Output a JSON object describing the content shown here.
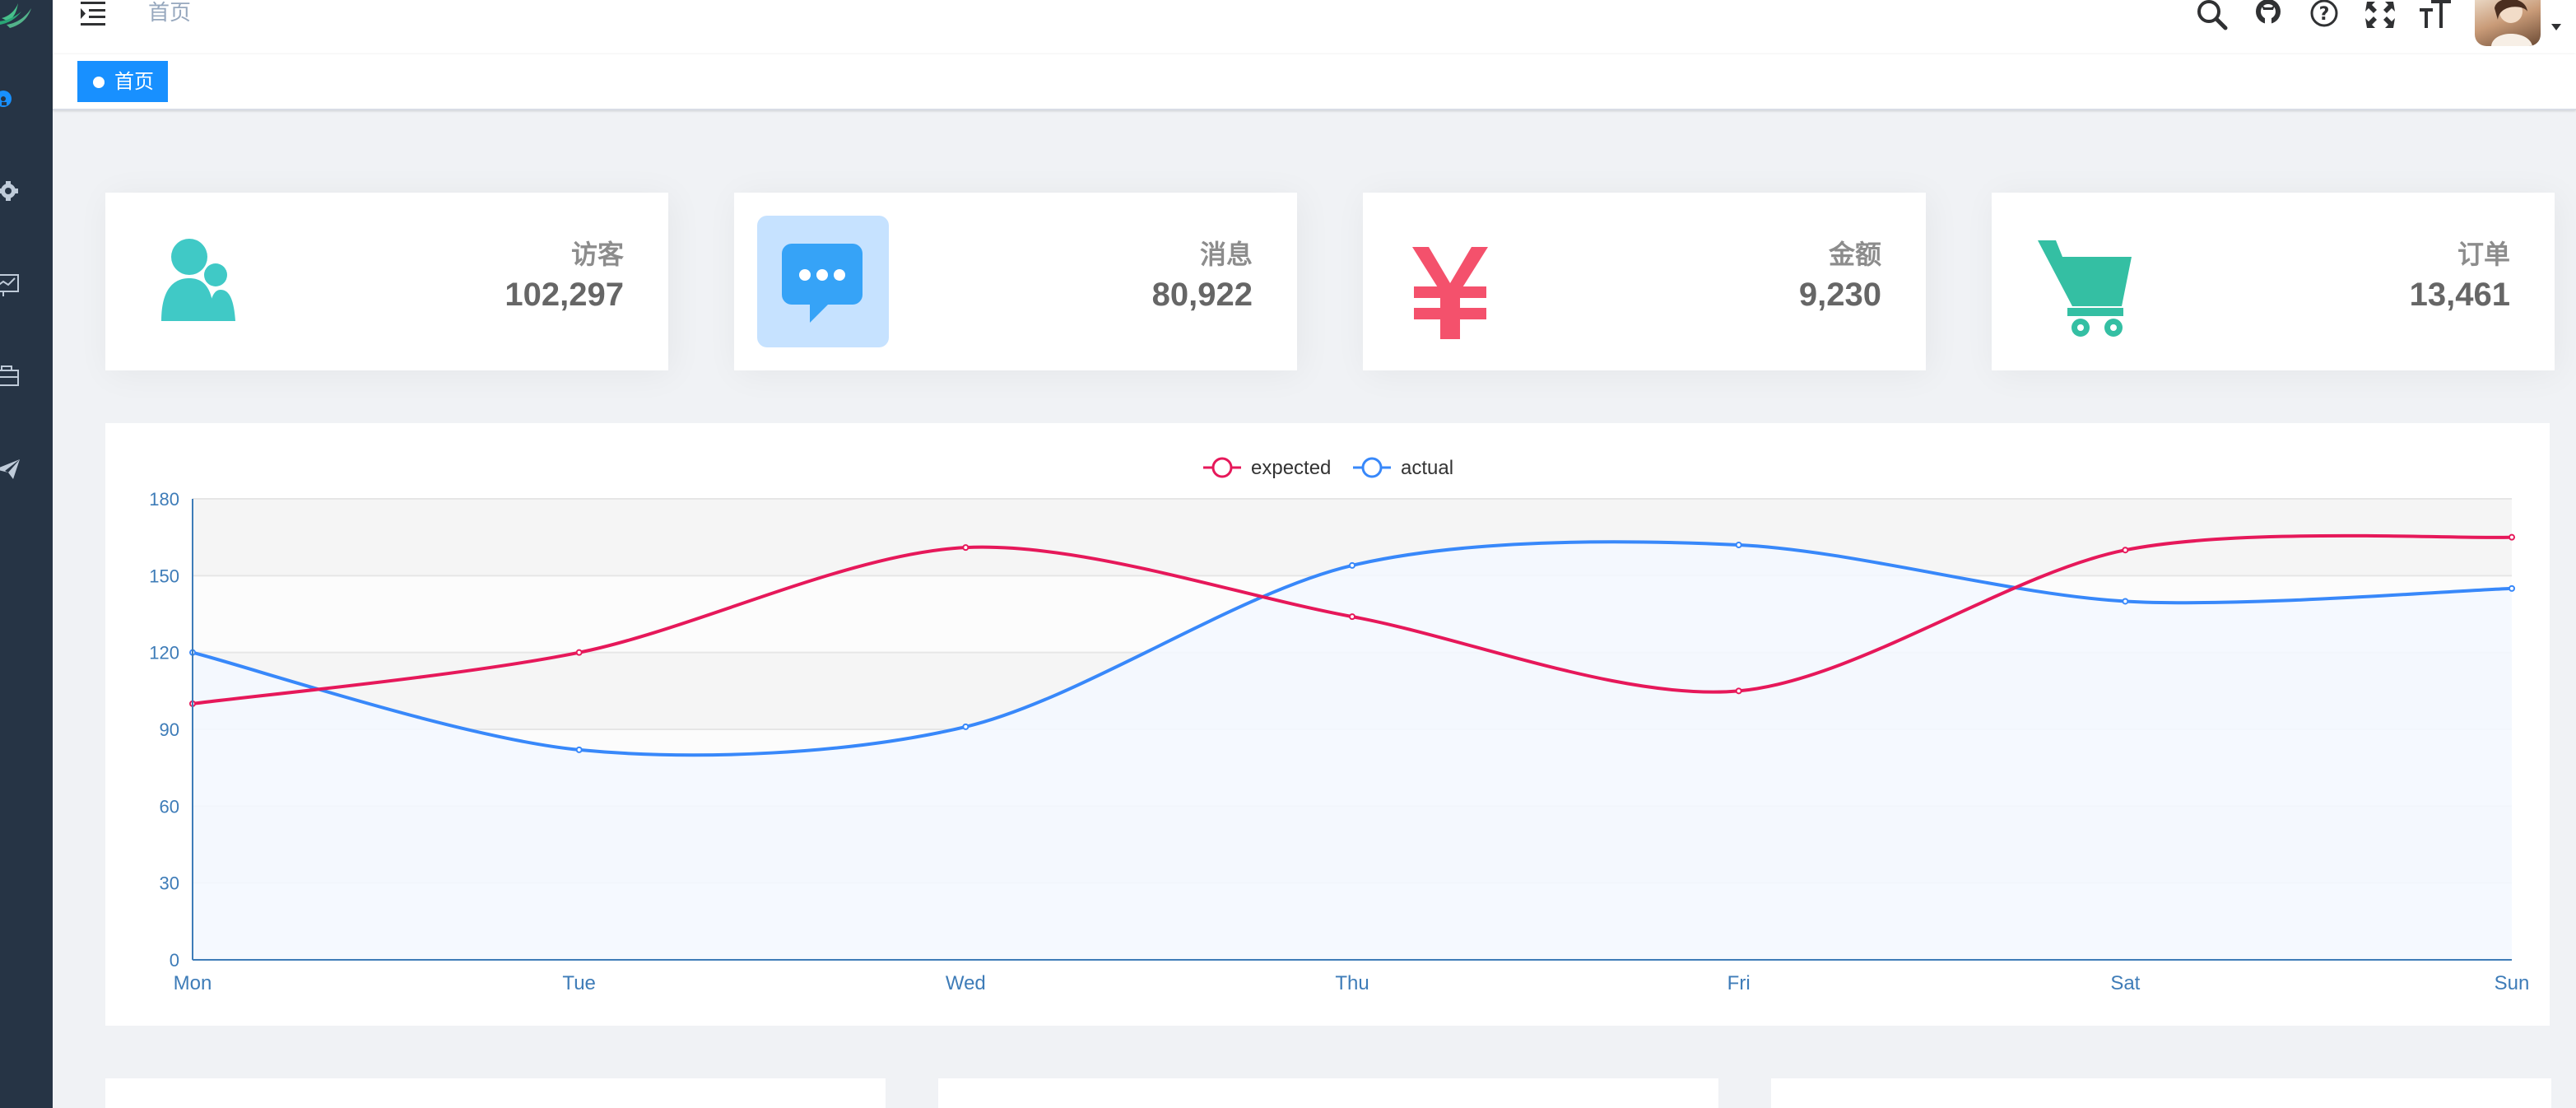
{
  "navbar": {
    "breadcrumb": "首页",
    "icons": [
      "search-icon",
      "github-icon",
      "help-icon",
      "fullscreen-icon",
      "font-size-icon"
    ]
  },
  "sidebar": {
    "items": [
      "dashboard-icon",
      "gear-icon",
      "chart-icon",
      "briefcase-icon",
      "paper-plane-icon"
    ],
    "active_color": "#1890ff"
  },
  "tags_view": {
    "tags": [
      {
        "label": "首页",
        "active": true
      }
    ]
  },
  "panels": [
    {
      "label": "访客",
      "value": "102,297",
      "icon": "people-icon",
      "color": "#40c9c6"
    },
    {
      "label": "消息",
      "value": "80,922",
      "icon": "message-icon",
      "color": "#36a3f7"
    },
    {
      "label": "金额",
      "value": "9,230",
      "icon": "money-icon",
      "color": "#f4516c"
    },
    {
      "label": "订单",
      "value": "13,461",
      "icon": "shopping-icon",
      "color": "#34bfa3"
    }
  ],
  "chart_data": {
    "type": "line",
    "categories": [
      "Mon",
      "Tue",
      "Wed",
      "Thu",
      "Fri",
      "Sat",
      "Sun"
    ],
    "series": [
      {
        "name": "expected",
        "values": [
          100,
          120,
          161,
          134,
          105,
          160,
          165
        ],
        "color": "#e6185a"
      },
      {
        "name": "actual",
        "values": [
          120,
          82,
          91,
          154,
          162,
          140,
          145
        ],
        "color": "#3888fa"
      }
    ],
    "y_ticks": [
      "0",
      "30",
      "60",
      "90",
      "120",
      "150",
      "180"
    ],
    "ylim": [
      0,
      180
    ],
    "legend_position": "top-center",
    "grid": true
  }
}
